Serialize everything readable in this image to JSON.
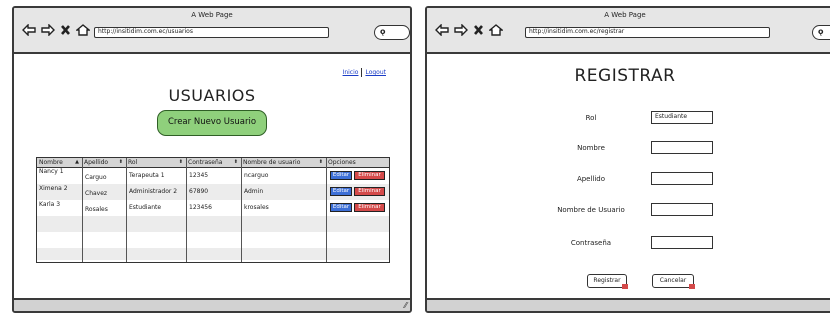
{
  "left_window": {
    "title": "A Web Page",
    "url": "http://insitidim.com.ec/usuarios",
    "links": {
      "inicio": "Inicio",
      "logout": "Logout"
    },
    "page_title": "USUARIOS",
    "create_button": "Crear Nuevo Usuario",
    "columns": [
      "Nombre",
      "Apellido",
      "Rol",
      "Contraseña",
      "Nombre de usuario",
      "Opciones"
    ],
    "rows": [
      {
        "nombre": "Nancy 1",
        "apellido": "Carguo",
        "rol": "Terapeuta 1",
        "contrasena": "12345",
        "usuario": "ncarguo",
        "edit": "Editar",
        "del": "Eliminar"
      },
      {
        "nombre": "Ximena 2",
        "apellido": "Chavez",
        "rol": "Administrador 2",
        "contrasena": "67890",
        "usuario": "Admin",
        "edit": "Editar",
        "del": "Eliminar"
      },
      {
        "nombre": "Karla 3",
        "apellido": "Rosales",
        "rol": "Estudiante",
        "contrasena": "123456",
        "usuario": "krosales",
        "edit": "Editar",
        "del": "Eliminar"
      }
    ]
  },
  "right_window": {
    "title": "A Web Page",
    "url": "http://insitidim.com.ec/registrar",
    "page_title": "REGISTRAR",
    "fields": {
      "rol": {
        "label": "Rol",
        "value": "Estudiante"
      },
      "nombre": {
        "label": "Nombre",
        "value": ""
      },
      "apellido": {
        "label": "Apellido",
        "value": ""
      },
      "usuario": {
        "label": "Nombre de Usuario",
        "value": ""
      },
      "contrasena": {
        "label": "Contraseña",
        "value": ""
      }
    },
    "buttons": {
      "registrar": "Registrar",
      "cancelar": "Cancelar"
    }
  },
  "colors": {
    "create_button": "#8fd07c",
    "edit_button": "#3d6fd6",
    "delete_button": "#d44a4a",
    "link": "#1a3cc7"
  }
}
